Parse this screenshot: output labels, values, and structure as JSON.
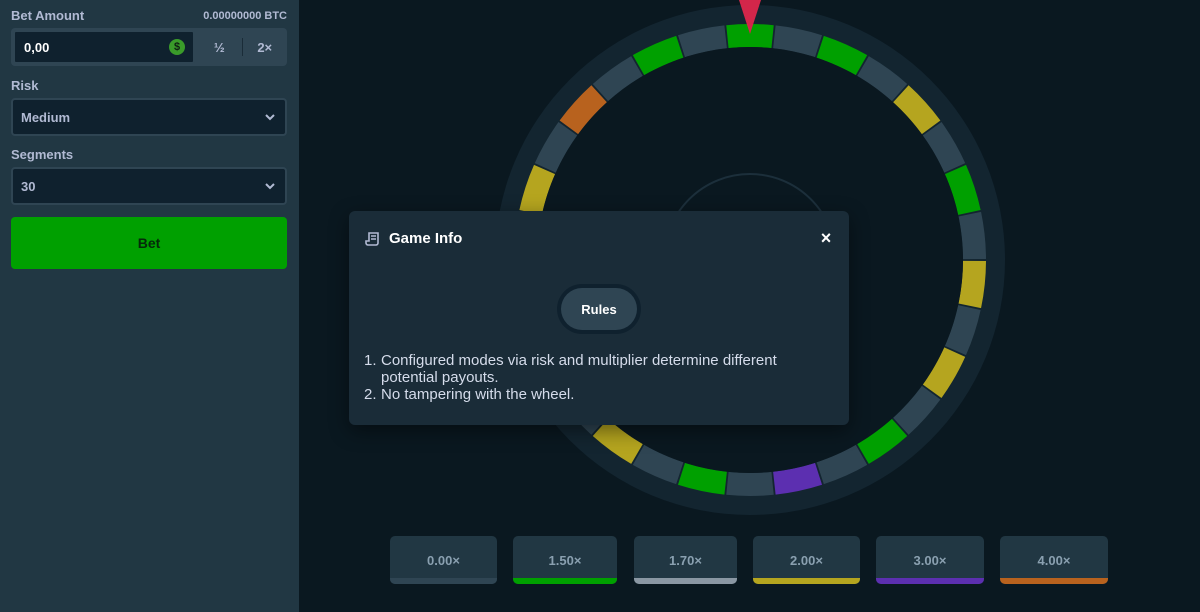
{
  "sidebar": {
    "bet_amount_label": "Bet Amount",
    "bet_amount_btc": "0.00000000 BTC",
    "bet_amount_value": "0,00",
    "currency_symbol": "$",
    "half_label": "½",
    "double_label": "2×",
    "risk_label": "Risk",
    "risk_value": "Medium",
    "segments_label": "Segments",
    "segments_value": "30",
    "bet_button": "Bet"
  },
  "wheel": {
    "segment_count": 30,
    "segment_colors": [
      "#00a000",
      "#2f4553",
      "#00a000",
      "#2f4553",
      "#b5a51f",
      "#2f4553",
      "#00a000",
      "#2f4553",
      "#b5a51f",
      "#2f4553",
      "#b5a51f",
      "#2f4553",
      "#00a000",
      "#2f4553",
      "#5c2fb0",
      "#2f4553",
      "#00a000",
      "#2f4553",
      "#b5a51f",
      "#2f4553",
      "#b5a51f",
      "#2f4553",
      "#00a000",
      "#2f4553",
      "#b5a51f",
      "#2f4553",
      "#b8621e",
      "#2f4553",
      "#00a000",
      "#2f4553"
    ],
    "pointer_color": "#d3264a"
  },
  "multipliers": [
    {
      "label": "0.00×",
      "color": "#2f4553"
    },
    {
      "label": "1.50×",
      "color": "#00a000"
    },
    {
      "label": "1.70×",
      "color": "#8a97a3"
    },
    {
      "label": "2.00×",
      "color": "#b5a51f"
    },
    {
      "label": "3.00×",
      "color": "#5c2fb0"
    },
    {
      "label": "4.00×",
      "color": "#b8621e"
    }
  ],
  "modal": {
    "title": "Game Info",
    "title_icon": "scroll-icon",
    "close_icon": "close-icon",
    "close_glyph": "×",
    "tab_rules": "Rules",
    "rules": [
      {
        "num": "1.",
        "text": "Configured modes via risk and multiplier determine different potential payouts."
      },
      {
        "num": "2.",
        "text": "No tampering with the wheel."
      }
    ]
  }
}
